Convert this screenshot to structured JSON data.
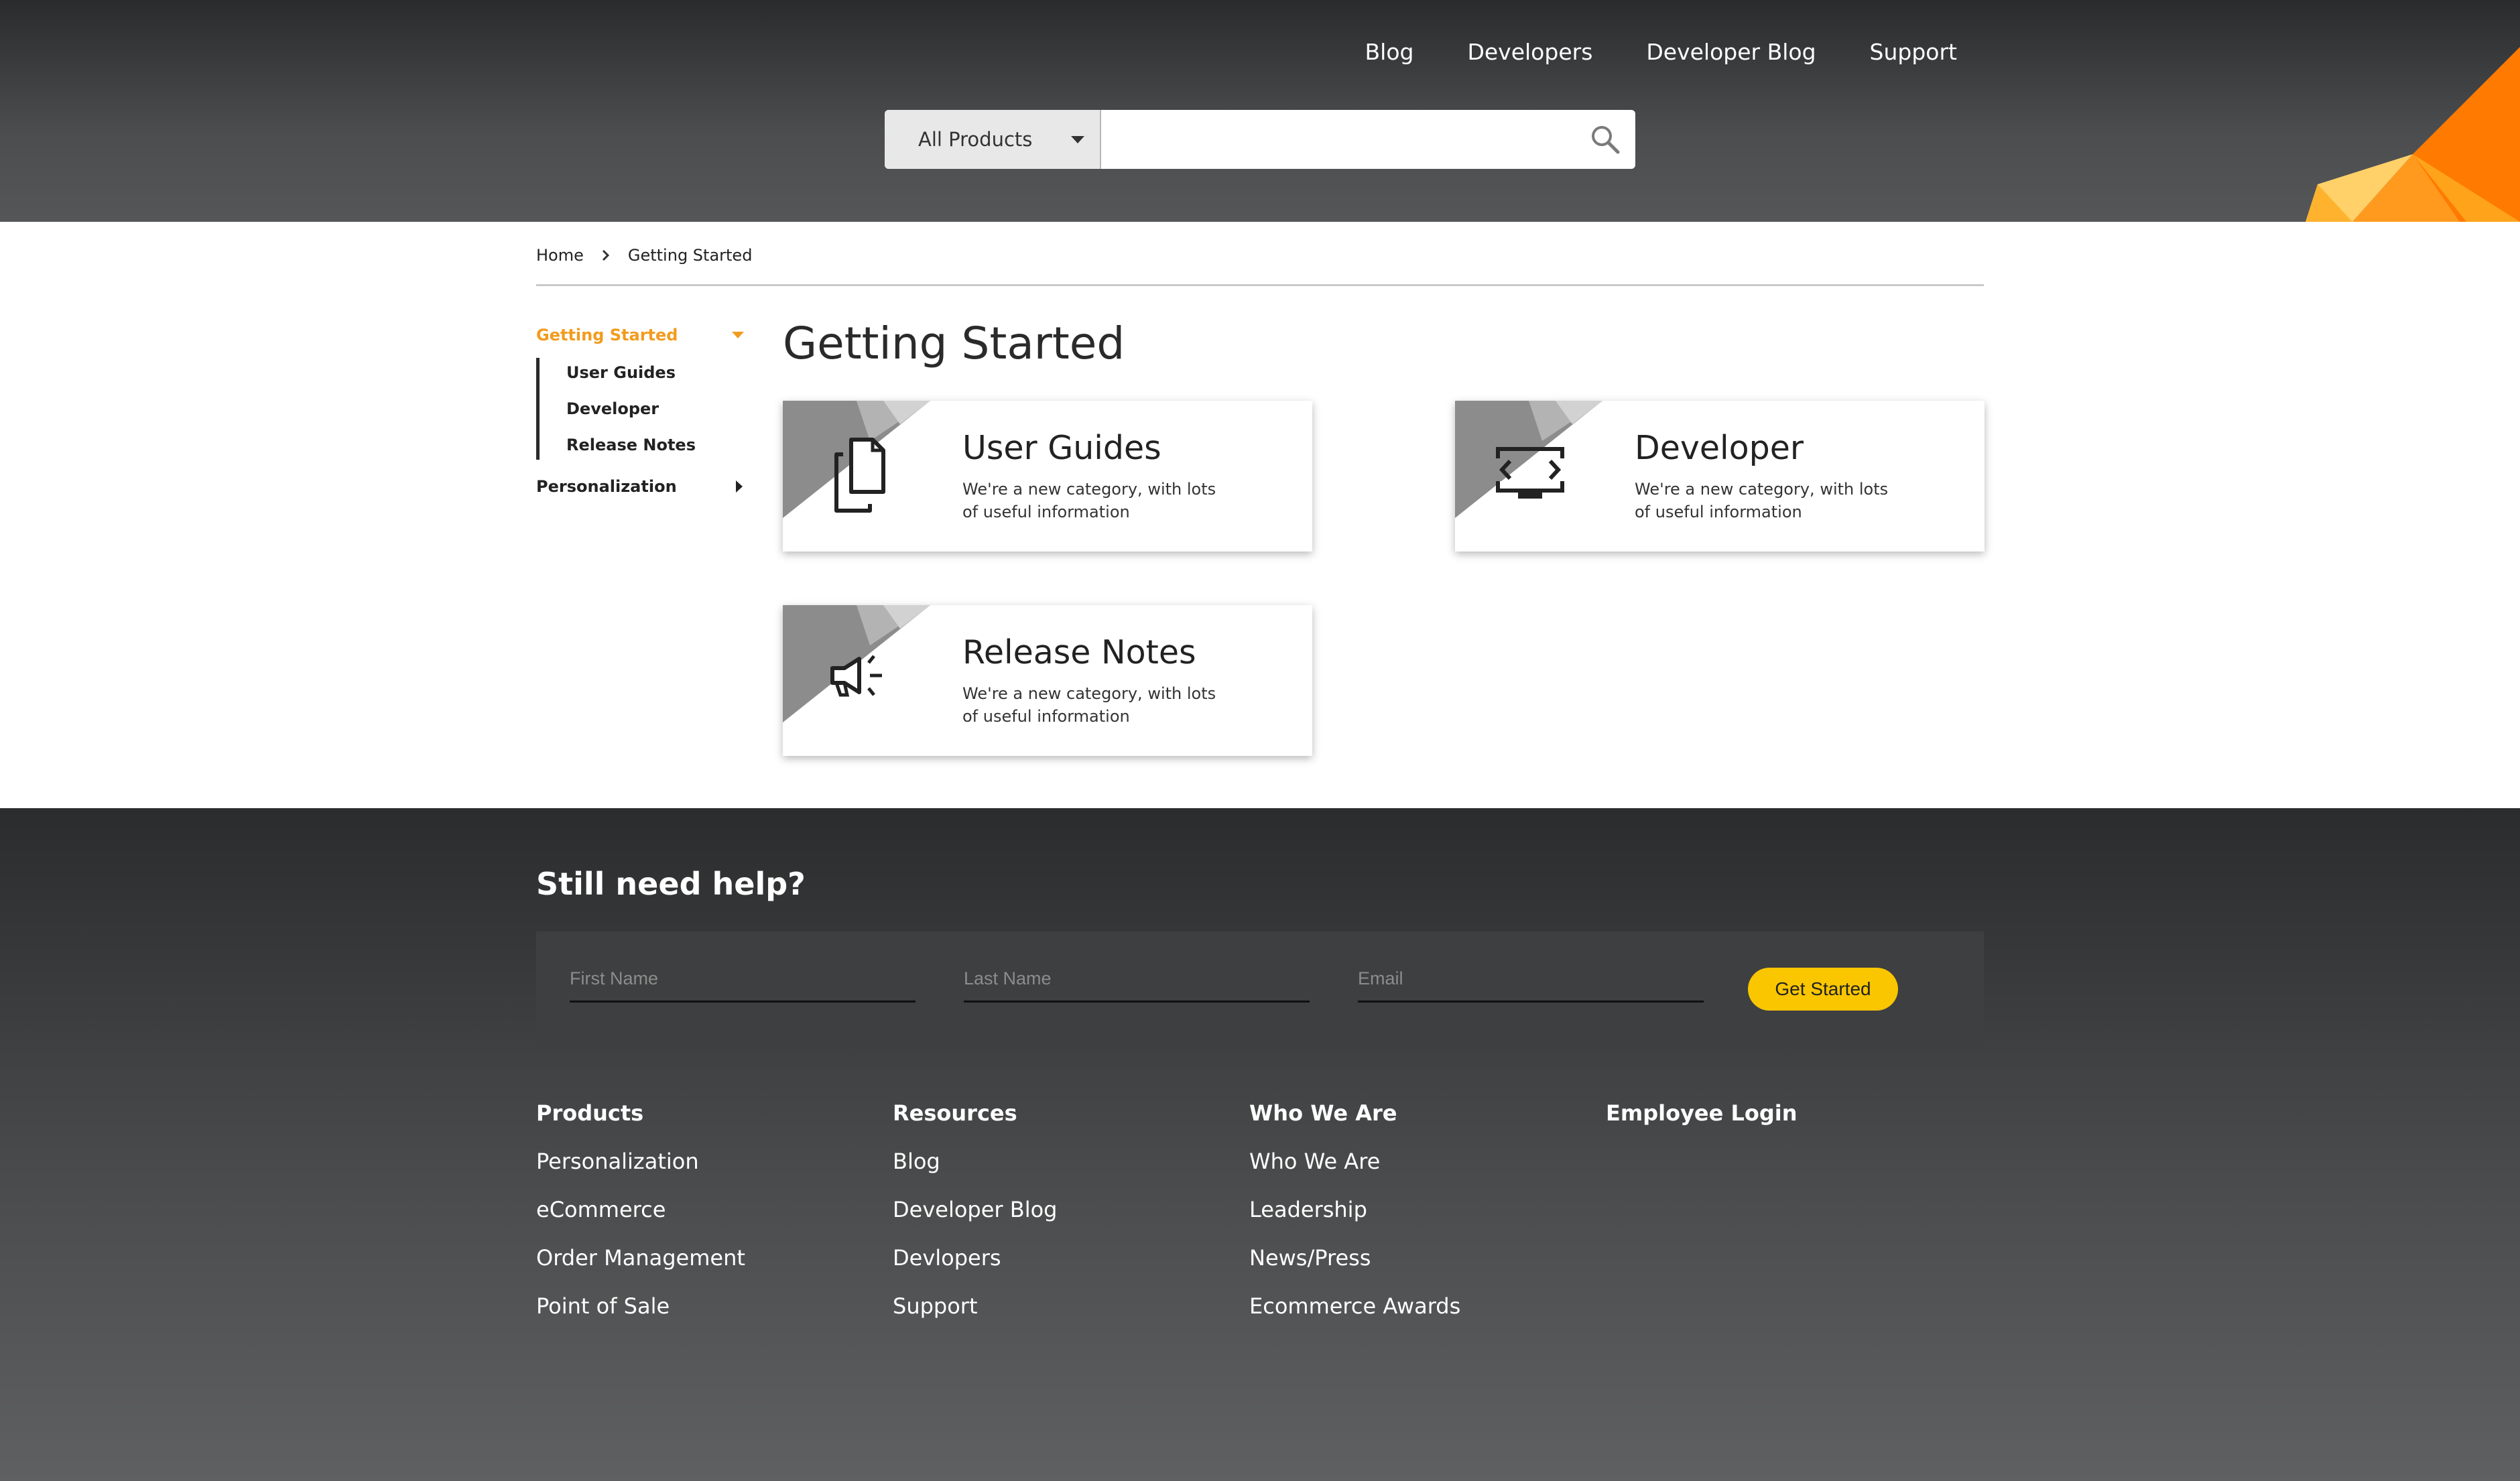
{
  "header": {
    "nav": [
      "Blog",
      "Developers",
      "Developer Blog",
      "Support"
    ],
    "search": {
      "category": "All Products",
      "placeholder": ""
    }
  },
  "breadcrumb": {
    "home": "Home",
    "current": "Getting Started"
  },
  "sidebar": {
    "active_label": "Getting Started",
    "sub_items": [
      "User Guides",
      "Developer",
      "Release Notes"
    ],
    "second_label": "Personalization"
  },
  "main": {
    "title": "Getting Started",
    "cards": [
      {
        "title": "User Guides",
        "desc": "We're a new category, with lots of useful information",
        "icon": "document-copy-icon"
      },
      {
        "title": "Developer",
        "desc": "We're a new category, with lots of useful information",
        "icon": "code-monitor-icon"
      },
      {
        "title": "Release Notes",
        "desc": "We're a new category, with lots of useful information",
        "icon": "megaphone-icon"
      }
    ]
  },
  "footer": {
    "help_title": "Still need help?",
    "form": {
      "first_name_placeholder": "First Name",
      "last_name_placeholder": "Last Name",
      "email_placeholder": "Email",
      "submit_label": "Get Started"
    },
    "columns": [
      {
        "heading": "Products",
        "links": [
          "Personalization",
          "eCommerce",
          "Order Management",
          "Point of Sale"
        ]
      },
      {
        "heading": "Resources",
        "links": [
          "Blog",
          "Developer Blog",
          "Devlopers",
          "Support"
        ]
      },
      {
        "heading": "Who We Are",
        "links": [
          "Who We Are",
          "Leadership",
          "News/Press",
          "Ecommerce Awards"
        ]
      },
      {
        "heading": "Employee Login",
        "links": []
      }
    ]
  },
  "colors": {
    "accent": "#f29b1d",
    "button": "#f9c600",
    "deco_orange": "#ff7a00"
  }
}
